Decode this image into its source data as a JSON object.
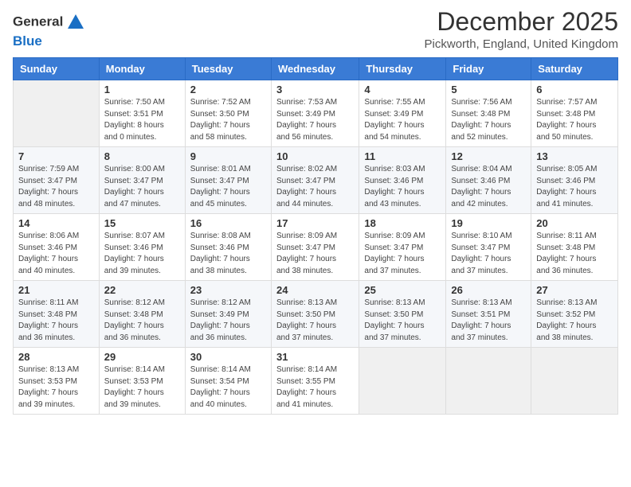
{
  "header": {
    "logo_line1": "General",
    "logo_line2": "Blue",
    "month_title": "December 2025",
    "location": "Pickworth, England, United Kingdom"
  },
  "days_of_week": [
    "Sunday",
    "Monday",
    "Tuesday",
    "Wednesday",
    "Thursday",
    "Friday",
    "Saturday"
  ],
  "weeks": [
    [
      {
        "day": "",
        "info": ""
      },
      {
        "day": "1",
        "info": "Sunrise: 7:50 AM\nSunset: 3:51 PM\nDaylight: 8 hours\nand 0 minutes."
      },
      {
        "day": "2",
        "info": "Sunrise: 7:52 AM\nSunset: 3:50 PM\nDaylight: 7 hours\nand 58 minutes."
      },
      {
        "day": "3",
        "info": "Sunrise: 7:53 AM\nSunset: 3:49 PM\nDaylight: 7 hours\nand 56 minutes."
      },
      {
        "day": "4",
        "info": "Sunrise: 7:55 AM\nSunset: 3:49 PM\nDaylight: 7 hours\nand 54 minutes."
      },
      {
        "day": "5",
        "info": "Sunrise: 7:56 AM\nSunset: 3:48 PM\nDaylight: 7 hours\nand 52 minutes."
      },
      {
        "day": "6",
        "info": "Sunrise: 7:57 AM\nSunset: 3:48 PM\nDaylight: 7 hours\nand 50 minutes."
      }
    ],
    [
      {
        "day": "7",
        "info": "Sunrise: 7:59 AM\nSunset: 3:47 PM\nDaylight: 7 hours\nand 48 minutes."
      },
      {
        "day": "8",
        "info": "Sunrise: 8:00 AM\nSunset: 3:47 PM\nDaylight: 7 hours\nand 47 minutes."
      },
      {
        "day": "9",
        "info": "Sunrise: 8:01 AM\nSunset: 3:47 PM\nDaylight: 7 hours\nand 45 minutes."
      },
      {
        "day": "10",
        "info": "Sunrise: 8:02 AM\nSunset: 3:47 PM\nDaylight: 7 hours\nand 44 minutes."
      },
      {
        "day": "11",
        "info": "Sunrise: 8:03 AM\nSunset: 3:46 PM\nDaylight: 7 hours\nand 43 minutes."
      },
      {
        "day": "12",
        "info": "Sunrise: 8:04 AM\nSunset: 3:46 PM\nDaylight: 7 hours\nand 42 minutes."
      },
      {
        "day": "13",
        "info": "Sunrise: 8:05 AM\nSunset: 3:46 PM\nDaylight: 7 hours\nand 41 minutes."
      }
    ],
    [
      {
        "day": "14",
        "info": "Sunrise: 8:06 AM\nSunset: 3:46 PM\nDaylight: 7 hours\nand 40 minutes."
      },
      {
        "day": "15",
        "info": "Sunrise: 8:07 AM\nSunset: 3:46 PM\nDaylight: 7 hours\nand 39 minutes."
      },
      {
        "day": "16",
        "info": "Sunrise: 8:08 AM\nSunset: 3:46 PM\nDaylight: 7 hours\nand 38 minutes."
      },
      {
        "day": "17",
        "info": "Sunrise: 8:09 AM\nSunset: 3:47 PM\nDaylight: 7 hours\nand 38 minutes."
      },
      {
        "day": "18",
        "info": "Sunrise: 8:09 AM\nSunset: 3:47 PM\nDaylight: 7 hours\nand 37 minutes."
      },
      {
        "day": "19",
        "info": "Sunrise: 8:10 AM\nSunset: 3:47 PM\nDaylight: 7 hours\nand 37 minutes."
      },
      {
        "day": "20",
        "info": "Sunrise: 8:11 AM\nSunset: 3:48 PM\nDaylight: 7 hours\nand 36 minutes."
      }
    ],
    [
      {
        "day": "21",
        "info": "Sunrise: 8:11 AM\nSunset: 3:48 PM\nDaylight: 7 hours\nand 36 minutes."
      },
      {
        "day": "22",
        "info": "Sunrise: 8:12 AM\nSunset: 3:48 PM\nDaylight: 7 hours\nand 36 minutes."
      },
      {
        "day": "23",
        "info": "Sunrise: 8:12 AM\nSunset: 3:49 PM\nDaylight: 7 hours\nand 36 minutes."
      },
      {
        "day": "24",
        "info": "Sunrise: 8:13 AM\nSunset: 3:50 PM\nDaylight: 7 hours\nand 37 minutes."
      },
      {
        "day": "25",
        "info": "Sunrise: 8:13 AM\nSunset: 3:50 PM\nDaylight: 7 hours\nand 37 minutes."
      },
      {
        "day": "26",
        "info": "Sunrise: 8:13 AM\nSunset: 3:51 PM\nDaylight: 7 hours\nand 37 minutes."
      },
      {
        "day": "27",
        "info": "Sunrise: 8:13 AM\nSunset: 3:52 PM\nDaylight: 7 hours\nand 38 minutes."
      }
    ],
    [
      {
        "day": "28",
        "info": "Sunrise: 8:13 AM\nSunset: 3:53 PM\nDaylight: 7 hours\nand 39 minutes."
      },
      {
        "day": "29",
        "info": "Sunrise: 8:14 AM\nSunset: 3:53 PM\nDaylight: 7 hours\nand 39 minutes."
      },
      {
        "day": "30",
        "info": "Sunrise: 8:14 AM\nSunset: 3:54 PM\nDaylight: 7 hours\nand 40 minutes."
      },
      {
        "day": "31",
        "info": "Sunrise: 8:14 AM\nSunset: 3:55 PM\nDaylight: 7 hours\nand 41 minutes."
      },
      {
        "day": "",
        "info": ""
      },
      {
        "day": "",
        "info": ""
      },
      {
        "day": "",
        "info": ""
      }
    ]
  ]
}
